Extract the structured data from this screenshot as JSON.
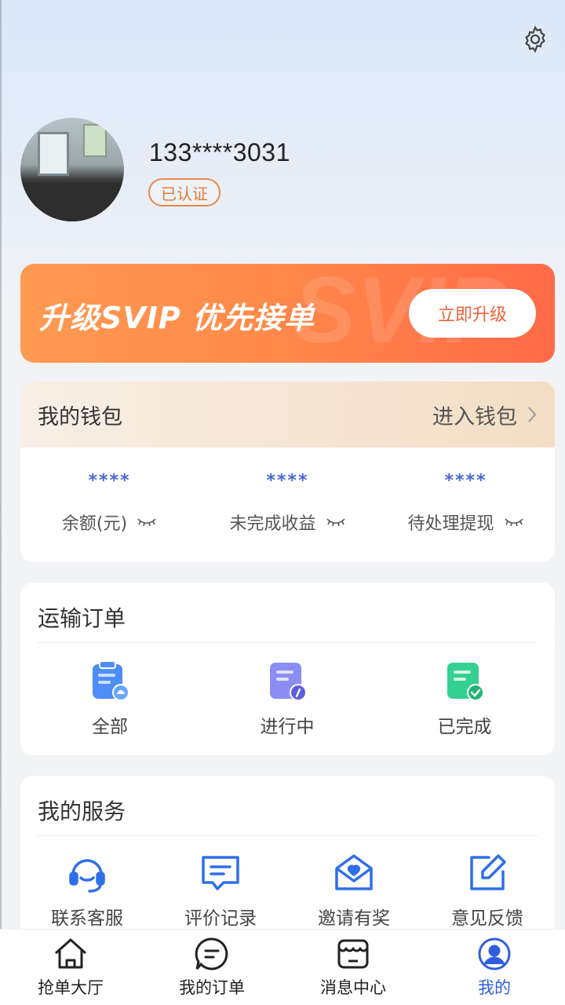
{
  "header": {
    "settings_icon": "gear-icon",
    "phone": "133****3031",
    "verified_badge": "已认证"
  },
  "svip": {
    "title": "升级SVIP  优先接单",
    "watermark": "SVIP",
    "button": "立即升级"
  },
  "wallet": {
    "title": "我的钱包",
    "enter": "进入钱包",
    "stats": [
      {
        "value": "****",
        "label": "余额(元)"
      },
      {
        "value": "****",
        "label": "未完成收益"
      },
      {
        "value": "****",
        "label": "待处理提现"
      }
    ]
  },
  "orders": {
    "title": "运输订单",
    "items": [
      {
        "label": "全部",
        "icon": "clipboard-all-icon",
        "color": "#4d8ef7"
      },
      {
        "label": "进行中",
        "icon": "clipboard-progress-icon",
        "color": "#7a7cf0"
      },
      {
        "label": "已完成",
        "icon": "clipboard-done-icon",
        "color": "#2fcf8a"
      }
    ]
  },
  "services": {
    "title": "我的服务",
    "items": [
      {
        "label": "联系客服",
        "icon": "headset-icon"
      },
      {
        "label": "评价记录",
        "icon": "comment-icon"
      },
      {
        "label": "邀请有奖",
        "icon": "gift-mail-icon"
      },
      {
        "label": "意见反馈",
        "icon": "edit-icon"
      }
    ]
  },
  "nav": {
    "items": [
      {
        "label": "抢单大厅",
        "icon": "home-icon"
      },
      {
        "label": "我的订单",
        "icon": "chat-order-icon"
      },
      {
        "label": "消息中心",
        "icon": "store-message-icon"
      },
      {
        "label": "我的",
        "icon": "user-icon"
      }
    ],
    "active_index": 3,
    "active_color": "#2f5fe0"
  }
}
